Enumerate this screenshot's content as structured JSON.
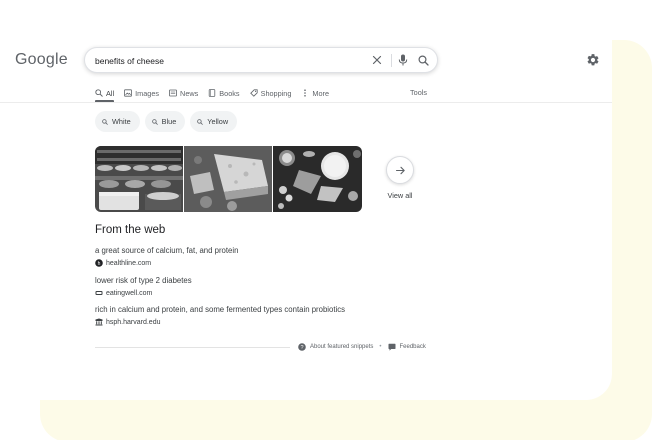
{
  "logo": "Google",
  "search": {
    "value": "benefits of cheese",
    "icons": [
      "clear-icon",
      "mic-icon",
      "search-icon"
    ]
  },
  "settings_icon": "gear-icon",
  "tabs": [
    {
      "label": "All",
      "icon": "search-icon",
      "active": true
    },
    {
      "label": "Images",
      "icon": "image-icon",
      "active": false
    },
    {
      "label": "News",
      "icon": "news-icon",
      "active": false
    },
    {
      "label": "Books",
      "icon": "book-icon",
      "active": false
    },
    {
      "label": "Shopping",
      "icon": "tag-icon",
      "active": false
    },
    {
      "label": "More",
      "icon": "more-vert-icon",
      "active": false
    }
  ],
  "tools_label": "Tools",
  "chips": [
    {
      "label": "White",
      "icon": "search-icon"
    },
    {
      "label": "Blue",
      "icon": "search-icon"
    },
    {
      "label": "Yellow",
      "icon": "search-icon"
    }
  ],
  "images": {
    "view_all_label": "View all",
    "arrow_icon": "arrow-right-icon"
  },
  "from_web": {
    "heading": "From the web",
    "items": [
      {
        "text": "a great source of calcium, fat, and protein",
        "source": "healthline.com",
        "favicon": "healthline-favicon-icon"
      },
      {
        "text": "lower risk of type 2 diabetes",
        "source": "eatingwell.com",
        "favicon": "eatingwell-favicon-icon"
      },
      {
        "text": "rich in calcium and protein, and some fermented types contain probiotics",
        "source": "hsph.harvard.edu",
        "favicon": "harvard-favicon-icon"
      }
    ]
  },
  "footer": {
    "about": "About featured snippets",
    "separator": "•",
    "feedback": "Feedback"
  },
  "colors": {
    "background_blob": "#fdfbe8",
    "text_primary": "#202124",
    "text_secondary": "#5f6368",
    "chip_bg": "#f1f3f4"
  }
}
